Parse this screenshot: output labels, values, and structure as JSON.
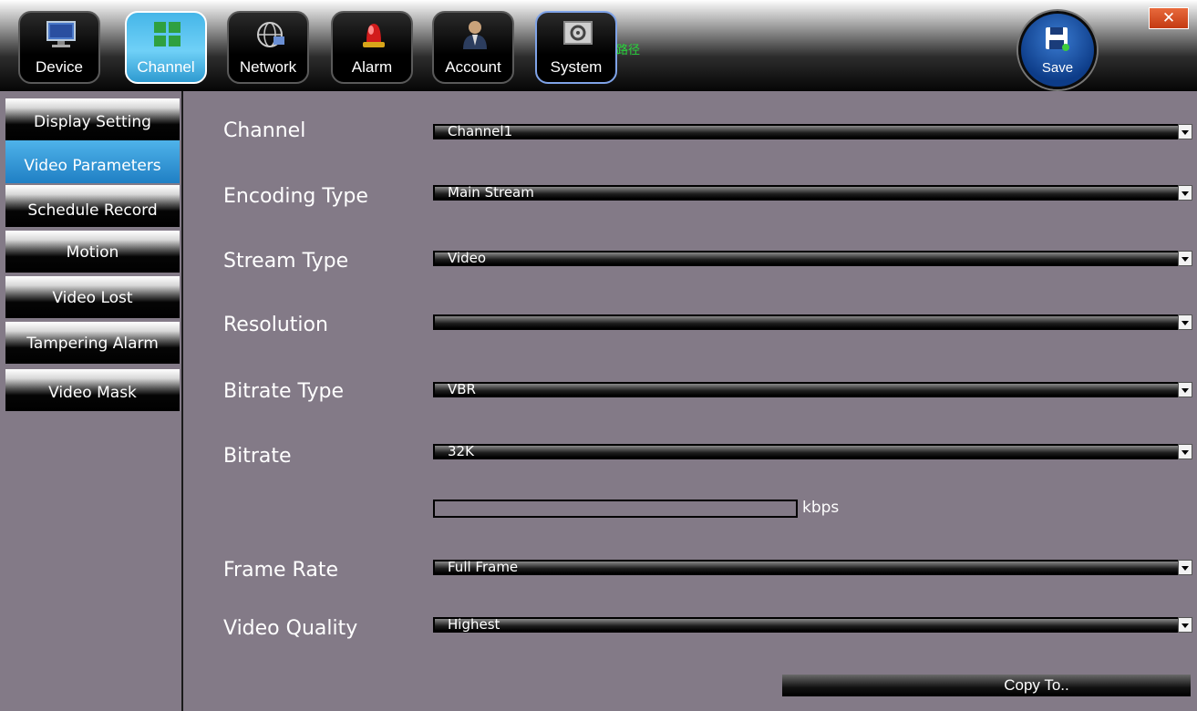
{
  "toolbar": {
    "buttons": [
      {
        "label": "Device",
        "icon": "monitor-icon"
      },
      {
        "label": "Channel",
        "icon": "channel-grid-icon"
      },
      {
        "label": "Network",
        "icon": "network-icon"
      },
      {
        "label": "Alarm",
        "icon": "alarm-light-icon"
      },
      {
        "label": "Account",
        "icon": "user-account-icon"
      },
      {
        "label": "System",
        "icon": "system-settings-icon"
      }
    ],
    "path_label": "路径",
    "save_label": "Save",
    "close_label": "✕",
    "active": "Channel"
  },
  "sidebar": {
    "items": [
      {
        "label": "Display Setting"
      },
      {
        "label": "Video Parameters"
      },
      {
        "label": "Schedule Record"
      },
      {
        "label": "Motion"
      },
      {
        "label": "Video Lost"
      },
      {
        "label": "Tampering Alarm"
      },
      {
        "label": "Video Mask"
      }
    ],
    "active": "Video Parameters"
  },
  "form": {
    "channel": {
      "label": "Channel",
      "value": "Channel1"
    },
    "encoding_type": {
      "label": "Encoding Type",
      "value": "Main Stream"
    },
    "stream_type": {
      "label": "Stream Type",
      "value": "Video"
    },
    "resolution": {
      "label": "Resolution",
      "value": ""
    },
    "bitrate_type": {
      "label": "Bitrate Type",
      "value": "VBR"
    },
    "bitrate": {
      "label": "Bitrate",
      "value": "32K"
    },
    "custom_bitrate": {
      "value": "",
      "unit": "kbps"
    },
    "frame_rate": {
      "label": "Frame Rate",
      "value": "Full Frame"
    },
    "video_quality": {
      "label": "Video Quality",
      "value": "Highest"
    }
  },
  "copy_to_label": "Copy To..",
  "colors": {
    "active_blue": "#45b6e8",
    "panel_bg": "#837a87",
    "path_green": "#27d43a"
  }
}
